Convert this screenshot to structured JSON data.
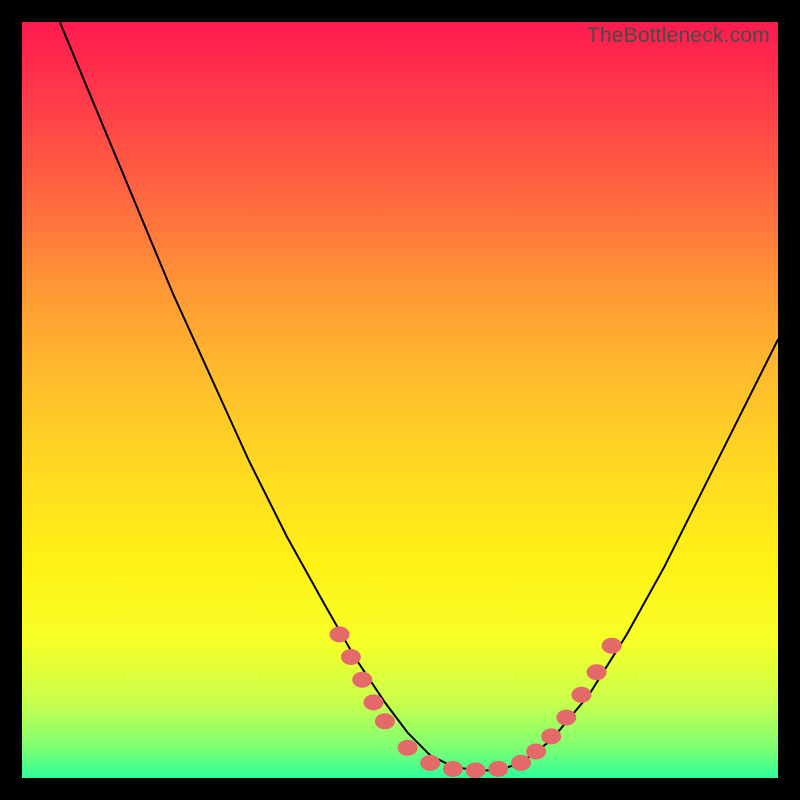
{
  "watermark": "TheBottleneck.com",
  "colors": {
    "background": "#000000",
    "curve": "#000000",
    "markers": "#e46a6a",
    "gradient_top": "#ff1a4e",
    "gradient_bottom": "#2eff9b"
  },
  "chart_data": {
    "type": "line",
    "title": "",
    "xlabel": "",
    "ylabel": "",
    "xlim": [
      0,
      100
    ],
    "ylim": [
      0,
      100
    ],
    "grid": false,
    "legend": false,
    "series": [
      {
        "name": "curve",
        "x": [
          5,
          10,
          15,
          20,
          25,
          30,
          35,
          40,
          44,
          48,
          51,
          54,
          57,
          60,
          63,
          66,
          70,
          75,
          80,
          85,
          90,
          95,
          100
        ],
        "y": [
          100,
          88,
          76,
          64,
          53,
          42,
          32,
          23,
          16,
          10,
          6,
          3,
          1.5,
          1,
          1,
          2,
          5,
          11,
          19,
          28,
          38,
          48,
          58
        ]
      }
    ],
    "markers": [
      {
        "x": 42,
        "y": 19
      },
      {
        "x": 43.5,
        "y": 16
      },
      {
        "x": 45,
        "y": 13
      },
      {
        "x": 46.5,
        "y": 10
      },
      {
        "x": 48,
        "y": 7.5
      },
      {
        "x": 51,
        "y": 4
      },
      {
        "x": 54,
        "y": 2
      },
      {
        "x": 57,
        "y": 1.2
      },
      {
        "x": 60,
        "y": 1
      },
      {
        "x": 63,
        "y": 1.2
      },
      {
        "x": 66,
        "y": 2
      },
      {
        "x": 68,
        "y": 3.5
      },
      {
        "x": 70,
        "y": 5.5
      },
      {
        "x": 72,
        "y": 8
      },
      {
        "x": 74,
        "y": 11
      },
      {
        "x": 76,
        "y": 14
      },
      {
        "x": 78,
        "y": 17.5
      }
    ]
  }
}
